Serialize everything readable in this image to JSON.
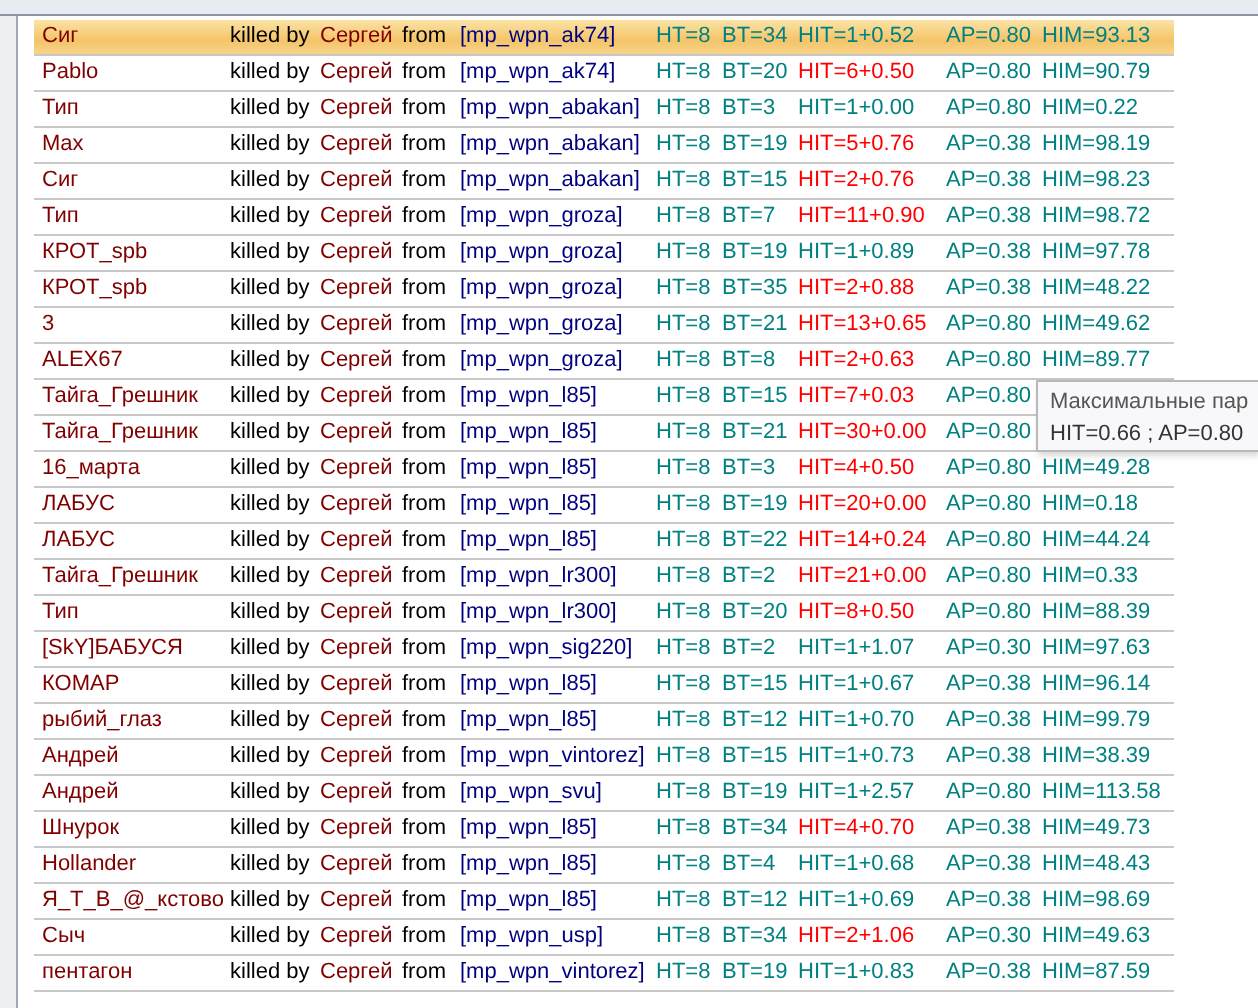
{
  "log": [
    {
      "victim": "Сиг",
      "killed_by": "killed by",
      "killer": "Сергей",
      "from": "from",
      "weapon": "[mp_wpn_ak74]",
      "ht": "HT=8",
      "bt": "BT=34",
      "hit": "HIT=1+0.52",
      "hit_alert": false,
      "ap": "AP=0.80",
      "him": "HIM=93.13",
      "selected": true
    },
    {
      "victim": "Pablo",
      "killed_by": "killed by",
      "killer": "Сергей",
      "from": "from",
      "weapon": "[mp_wpn_ak74]",
      "ht": "HT=8",
      "bt": "BT=20",
      "hit": "HIT=6+0.50",
      "hit_alert": true,
      "ap": "AP=0.80",
      "him": "HIM=90.79",
      "selected": false
    },
    {
      "victim": "Тип",
      "killed_by": "killed by",
      "killer": "Сергей",
      "from": "from",
      "weapon": "[mp_wpn_abakan]",
      "ht": "HT=8",
      "bt": "BT=3",
      "hit": "HIT=1+0.00",
      "hit_alert": false,
      "ap": "AP=0.80",
      "him": "HIM=0.22",
      "selected": false
    },
    {
      "victim": "Max",
      "killed_by": "killed by",
      "killer": "Сергей",
      "from": "from",
      "weapon": "[mp_wpn_abakan]",
      "ht": "HT=8",
      "bt": "BT=19",
      "hit": "HIT=5+0.76",
      "hit_alert": true,
      "ap": "AP=0.38",
      "him": "HIM=98.19",
      "selected": false
    },
    {
      "victim": "Сиг",
      "killed_by": "killed by",
      "killer": "Сергей",
      "from": "from",
      "weapon": "[mp_wpn_abakan]",
      "ht": "HT=8",
      "bt": "BT=15",
      "hit": "HIT=2+0.76",
      "hit_alert": true,
      "ap": "AP=0.38",
      "him": "HIM=98.23",
      "selected": false
    },
    {
      "victim": "Тип",
      "killed_by": "killed by",
      "killer": "Сергей",
      "from": "from",
      "weapon": "[mp_wpn_groza]",
      "ht": "HT=8",
      "bt": "BT=7",
      "hit": "HIT=11+0.90",
      "hit_alert": true,
      "ap": "AP=0.38",
      "him": "HIM=98.72",
      "selected": false
    },
    {
      "victim": "КРОТ_spb",
      "killed_by": "killed by",
      "killer": "Сергей",
      "from": "from",
      "weapon": "[mp_wpn_groza]",
      "ht": "HT=8",
      "bt": "BT=19",
      "hit": "HIT=1+0.89",
      "hit_alert": false,
      "ap": "AP=0.38",
      "him": "HIM=97.78",
      "selected": false
    },
    {
      "victim": "КРОТ_spb",
      "killed_by": "killed by",
      "killer": "Сергей",
      "from": "from",
      "weapon": "[mp_wpn_groza]",
      "ht": "HT=8",
      "bt": "BT=35",
      "hit": "HIT=2+0.88",
      "hit_alert": true,
      "ap": "AP=0.38",
      "him": "HIM=48.22",
      "selected": false
    },
    {
      "victim": "3",
      "killed_by": "killed by",
      "killer": "Сергей",
      "from": "from",
      "weapon": "[mp_wpn_groza]",
      "ht": "HT=8",
      "bt": "BT=21",
      "hit": "HIT=13+0.65",
      "hit_alert": true,
      "ap": "AP=0.80",
      "him": "HIM=49.62",
      "selected": false
    },
    {
      "victim": "ALEX67",
      "killed_by": "killed by",
      "killer": "Сергей",
      "from": "from",
      "weapon": "[mp_wpn_groza]",
      "ht": "HT=8",
      "bt": "BT=8",
      "hit": "HIT=2+0.63",
      "hit_alert": true,
      "ap": "AP=0.80",
      "him": "HIM=89.77",
      "selected": false
    },
    {
      "victim": "Тайга_Грешник",
      "killed_by": "killed by",
      "killer": "Сергей",
      "from": "from",
      "weapon": "[mp_wpn_l85]",
      "ht": "HT=8",
      "bt": "BT=15",
      "hit": "HIT=7+0.03",
      "hit_alert": true,
      "ap": "AP=0.80",
      "selected": false
    },
    {
      "victim": "Тайга_Грешник",
      "killed_by": "killed by",
      "killer": "Сергей",
      "from": "from",
      "weapon": "[mp_wpn_l85]",
      "ht": "HT=8",
      "bt": "BT=21",
      "hit": "HIT=30+0.00",
      "hit_alert": true,
      "ap": "AP=0.80",
      "selected": false
    },
    {
      "victim": "16_марта",
      "killed_by": "killed by",
      "killer": "Сергей",
      "from": "from",
      "weapon": "[mp_wpn_l85]",
      "ht": "HT=8",
      "bt": "BT=3",
      "hit": "HIT=4+0.50",
      "hit_alert": true,
      "ap": "AP=0.80",
      "him": "HIM=49.28",
      "selected": false
    },
    {
      "victim": "ЛАБУС",
      "killed_by": "killed by",
      "killer": "Сергей",
      "from": "from",
      "weapon": "[mp_wpn_l85]",
      "ht": "HT=8",
      "bt": "BT=19",
      "hit": "HIT=20+0.00",
      "hit_alert": true,
      "ap": "AP=0.80",
      "him": "HIM=0.18",
      "selected": false
    },
    {
      "victim": "ЛАБУС",
      "killed_by": "killed by",
      "killer": "Сергей",
      "from": "from",
      "weapon": "[mp_wpn_l85]",
      "ht": "HT=8",
      "bt": "BT=22",
      "hit": "HIT=14+0.24",
      "hit_alert": true,
      "ap": "AP=0.80",
      "him": "HIM=44.24",
      "selected": false
    },
    {
      "victim": "Тайга_Грешник",
      "killed_by": "killed by",
      "killer": "Сергей",
      "from": "from",
      "weapon": "[mp_wpn_lr300]",
      "ht": "HT=8",
      "bt": "BT=2",
      "hit": "HIT=21+0.00",
      "hit_alert": true,
      "ap": "AP=0.80",
      "him": "HIM=0.33",
      "selected": false
    },
    {
      "victim": "Тип",
      "killed_by": "killed by",
      "killer": "Сергей",
      "from": "from",
      "weapon": "[mp_wpn_lr300]",
      "ht": "HT=8",
      "bt": "BT=20",
      "hit": "HIT=8+0.50",
      "hit_alert": true,
      "ap": "AP=0.80",
      "him": "HIM=88.39",
      "selected": false
    },
    {
      "victim": "[SkY]БАБУСЯ",
      "killed_by": "killed by",
      "killer": "Сергей",
      "from": "from",
      "weapon": "[mp_wpn_sig220]",
      "ht": "HT=8",
      "bt": "BT=2",
      "hit": "HIT=1+1.07",
      "hit_alert": false,
      "ap": "AP=0.30",
      "him": "HIM=97.63",
      "selected": false
    },
    {
      "victim": "КОМАР",
      "killed_by": "killed by",
      "killer": "Сергей",
      "from": "from",
      "weapon": "[mp_wpn_l85]",
      "ht": "HT=8",
      "bt": "BT=15",
      "hit": "HIT=1+0.67",
      "hit_alert": false,
      "ap": "AP=0.38",
      "him": "HIM=96.14",
      "selected": false
    },
    {
      "victim": "рыбий_глаз",
      "killed_by": "killed by",
      "killer": "Сергей",
      "from": "from",
      "weapon": "[mp_wpn_l85]",
      "ht": "HT=8",
      "bt": "BT=12",
      "hit": "HIT=1+0.70",
      "hit_alert": false,
      "ap": "AP=0.38",
      "him": "HIM=99.79",
      "selected": false
    },
    {
      "victim": "Андрей",
      "killed_by": "killed by",
      "killer": "Сергей",
      "from": "from",
      "weapon": "[mp_wpn_vintorez]",
      "ht": "HT=8",
      "bt": "BT=15",
      "hit": "HIT=1+0.73",
      "hit_alert": false,
      "ap": "AP=0.38",
      "him": "HIM=38.39",
      "selected": false
    },
    {
      "victim": "Андрей",
      "killed_by": "killed by",
      "killer": "Сергей",
      "from": "from",
      "weapon": "[mp_wpn_svu]",
      "ht": "HT=8",
      "bt": "BT=19",
      "hit": "HIT=1+2.57",
      "hit_alert": false,
      "ap": "AP=0.80",
      "him": "HIM=113.58",
      "selected": false
    },
    {
      "victim": "Шнурок",
      "killed_by": "killed by",
      "killer": "Сергей",
      "from": "from",
      "weapon": "[mp_wpn_l85]",
      "ht": "HT=8",
      "bt": "BT=34",
      "hit": "HIT=4+0.70",
      "hit_alert": true,
      "ap": "AP=0.38",
      "him": "HIM=49.73",
      "selected": false
    },
    {
      "victim": "Hollander",
      "killed_by": "killed by",
      "killer": "Сергей",
      "from": "from",
      "weapon": "[mp_wpn_l85]",
      "ht": "HT=8",
      "bt": "BT=4",
      "hit": "HIT=1+0.68",
      "hit_alert": false,
      "ap": "AP=0.38",
      "him": "HIM=48.43",
      "selected": false
    },
    {
      "victim": "Я_Т_В_@_кстово",
      "killed_by": "killed by",
      "killer": "Сергей",
      "from": "from",
      "weapon": "[mp_wpn_l85]",
      "ht": "HT=8",
      "bt": "BT=12",
      "hit": "HIT=1+0.69",
      "hit_alert": false,
      "ap": "AP=0.38",
      "him": "HIM=98.69",
      "selected": false
    },
    {
      "victim": "Сыч",
      "killed_by": "killed by",
      "killer": "Сергей",
      "from": "from",
      "weapon": "[mp_wpn_usp]",
      "ht": "HT=8",
      "bt": "BT=34",
      "hit": "HIT=2+1.06",
      "hit_alert": true,
      "ap": "AP=0.30",
      "him": "HIM=49.63",
      "selected": false
    },
    {
      "victim": "пентагон",
      "killed_by": "killed by",
      "killer": "Сергей",
      "from": "from",
      "weapon": "[mp_wpn_vintorez]",
      "ht": "HT=8",
      "bt": "BT=19",
      "hit": "HIT=1+0.83",
      "hit_alert": false,
      "ap": "AP=0.38",
      "him": "HIM=87.59",
      "selected": false
    }
  ],
  "tooltip": {
    "title": "Максимальные пар",
    "text": "HIT=0.66 ; AP=0.80"
  }
}
